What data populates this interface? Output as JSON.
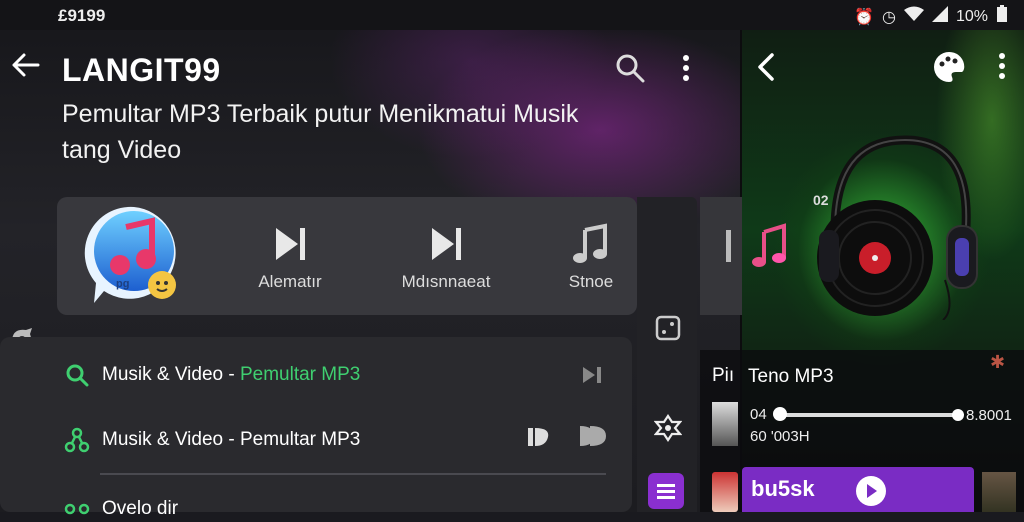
{
  "status_bar": {
    "time": "£9199",
    "icons": [
      "alarm-icon",
      "timer-icon",
      "wifi-icon",
      "signal-icon",
      "battery-icon"
    ],
    "battery_text": "10%"
  },
  "header": {
    "title": "LANGIT99",
    "subtitle": "Pemultar MP3 Terbaik  putur Menikmatui Musik tang Video"
  },
  "app_logo": {
    "badge_text": "pg"
  },
  "controls": [
    {
      "label": "Alematır",
      "icon": "skip-next-icon"
    },
    {
      "label": "Mdısnnaeat",
      "icon": "skip-next-icon"
    },
    {
      "label": "Stnoe",
      "icon": "music-note-icon"
    }
  ],
  "list": {
    "row1": {
      "prefix": "Musik & Video - ",
      "highlight": "Pemultar MP3"
    },
    "row2": {
      "text": "Musik & Video - Pemultar MP3"
    },
    "row3": {
      "text": "Ovelo dir"
    }
  },
  "right_panel": {
    "small_label": "02",
    "title_prefix": "Piı",
    "track_title": "Teno MP3",
    "time_left": "04",
    "time_left2": "60 '003H",
    "time_right": "8.8001",
    "progress": 0.02,
    "bottom_label": "bu5sk"
  },
  "colors": {
    "accent_green": "#3fcf70",
    "accent_purple": "#7a2cc4",
    "progress_blue": "#3a9bd8"
  }
}
